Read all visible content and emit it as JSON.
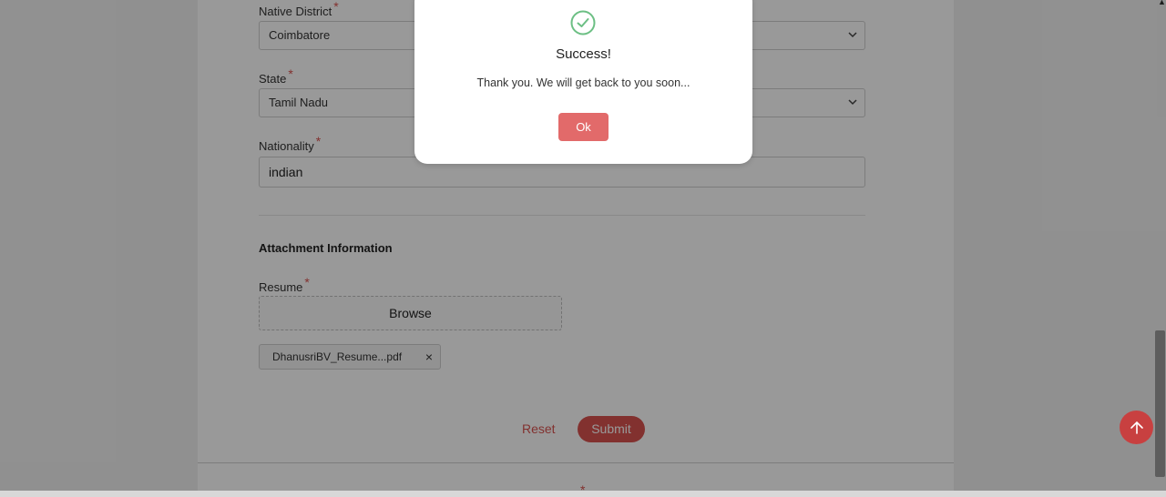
{
  "form": {
    "native_district": {
      "label": "Native District",
      "value": "Coimbatore"
    },
    "state": {
      "label": "State",
      "value": "Tamil Nadu"
    },
    "nationality": {
      "label": "Nationality",
      "value": "indian"
    },
    "required_mark": "*",
    "attachment_section_title": "Attachment Information",
    "resume": {
      "label": "Resume",
      "browse_label": "Browse",
      "file_name": "DhanusriBV_Resume...pdf",
      "remove_glyph": "×"
    },
    "reset_label": "Reset",
    "submit_label": "Submit"
  },
  "modal": {
    "icon": "check-circle-icon",
    "title": "Success!",
    "message": "Thank you. We will get back to you soon...",
    "ok_label": "Ok"
  },
  "colors": {
    "accent": "#d9534f",
    "ok_button": "#e26a6a",
    "success_green": "#6cbf84"
  }
}
